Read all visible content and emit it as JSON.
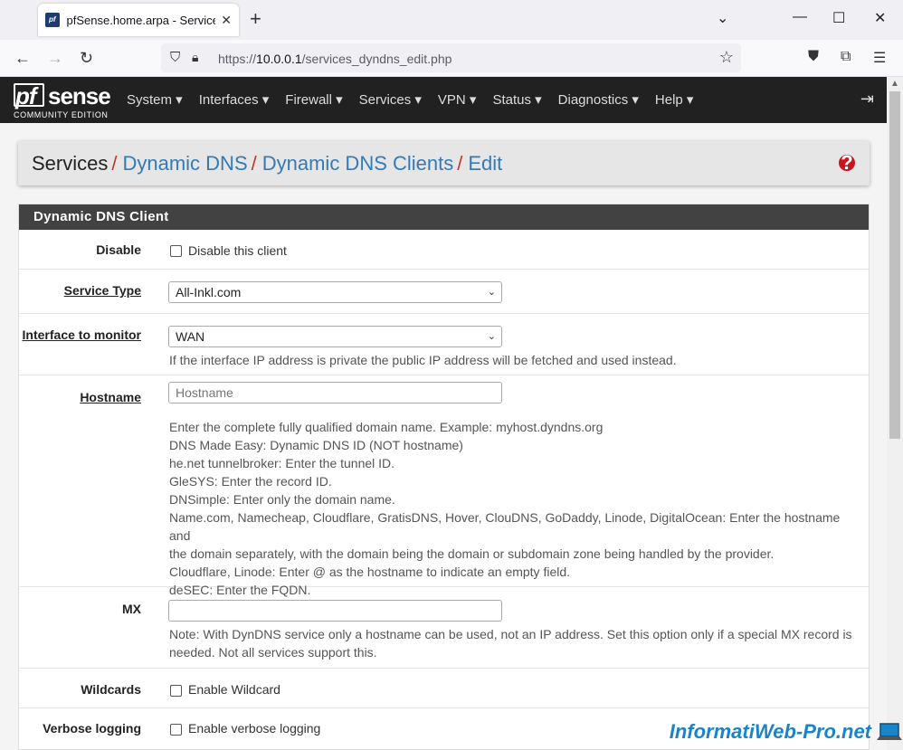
{
  "browser": {
    "tab_title": "pfSense.home.arpa - Services: D",
    "favicon_text": "pf",
    "url_prefix": "https://",
    "url_host": "10.0.0.1",
    "url_path": "/services_dyndns_edit.php"
  },
  "header": {
    "logo_pf": "pf",
    "logo_sense": "sense",
    "logo_edition": "COMMUNITY EDITION",
    "menu": [
      {
        "label": "System ▾"
      },
      {
        "label": "Interfaces ▾"
      },
      {
        "label": "Firewall ▾"
      },
      {
        "label": "Services ▾"
      },
      {
        "label": "VPN ▾"
      },
      {
        "label": "Status ▾"
      },
      {
        "label": "Diagnostics ▾"
      },
      {
        "label": "Help ▾"
      }
    ]
  },
  "breadcrumb": {
    "items": [
      "Services",
      "Dynamic DNS",
      "Dynamic DNS Clients",
      "Edit"
    ],
    "separator": "/"
  },
  "panel": {
    "title": "Dynamic DNS Client",
    "disable": {
      "label": "Disable",
      "checkbox_label": "Disable this client"
    },
    "service_type": {
      "label": "Service Type",
      "value": "All-Inkl.com"
    },
    "interface": {
      "label": "Interface to monitor",
      "value": "WAN",
      "help": "If the interface IP address is private the public IP address will be fetched and used instead."
    },
    "hostname": {
      "label": "Hostname",
      "placeholder": "Hostname",
      "help": [
        "Enter the complete fully qualified domain name. Example: myhost.dyndns.org",
        "DNS Made Easy: Dynamic DNS ID (NOT hostname)",
        "he.net tunnelbroker: Enter the tunnel ID.",
        "GleSYS: Enter the record ID.",
        "DNSimple: Enter only the domain name.",
        "Name.com, Namecheap, Cloudflare, GratisDNS, Hover, ClouDNS, GoDaddy, Linode, DigitalOcean: Enter the hostname and",
        "the domain separately, with the domain being the domain or subdomain zone being handled by the provider.",
        "Cloudflare, Linode: Enter @ as the hostname to indicate an empty field.",
        "deSEC: Enter the FQDN."
      ]
    },
    "mx": {
      "label": "MX",
      "value": "",
      "help": [
        "Note: With DynDNS service only a hostname can be used, not an IP address. Set this option only if a special MX record is",
        "needed. Not all services support this."
      ]
    },
    "wildcards": {
      "label": "Wildcards",
      "checkbox_label": "Enable Wildcard"
    },
    "verbose": {
      "label": "Verbose logging",
      "checkbox_label": "Enable verbose logging"
    }
  },
  "watermark": "InformatiWeb-Pro.net",
  "colors": {
    "header_bg": "#212121",
    "link": "#337ab7",
    "separator": "#c0392b",
    "panel_heading": "#424242"
  }
}
